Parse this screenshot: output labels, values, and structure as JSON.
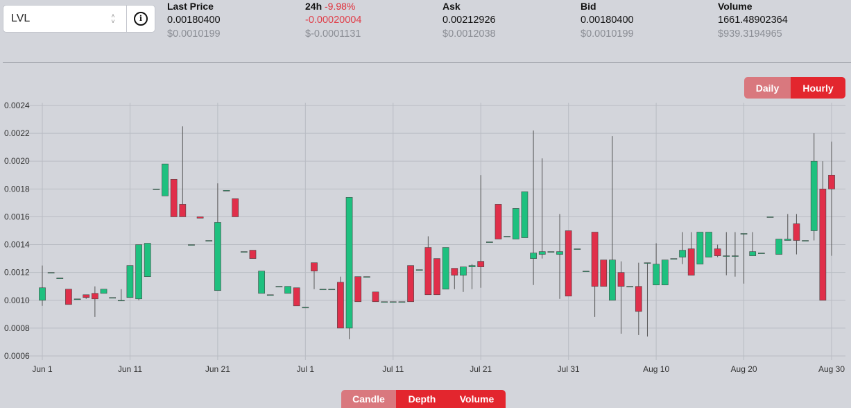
{
  "pair": {
    "symbol": "LVL"
  },
  "stats": [
    {
      "label": "Last Price",
      "pct": "",
      "value": "0.00180400",
      "usd": "$0.0010199"
    },
    {
      "label": "24h",
      "pct": "-9.98%",
      "value": "-0.00020004",
      "usd": "$-0.0001131"
    },
    {
      "label": "Ask",
      "pct": "",
      "value": "0.00212926",
      "usd": "$0.0012038"
    },
    {
      "label": "Bid",
      "pct": "",
      "value": "0.00180400",
      "usd": "$0.0010199"
    },
    {
      "label": "Volume",
      "pct": "",
      "value": "1661.48902364",
      "usd": "$939.3194965"
    }
  ],
  "interval_toggle": {
    "daily": "Daily",
    "hourly": "Hourly",
    "active": "Hourly"
  },
  "view_toggle": {
    "candle": "Candle",
    "depth": "Depth",
    "volume": "Volume"
  },
  "colors": {
    "up": "#1ec07f",
    "down": "#e02f4a",
    "wick": "#555555",
    "grid": "#b9bcc3"
  },
  "chart_data": {
    "type": "candlestick",
    "title": "",
    "xlabel": "",
    "ylabel": "",
    "ylim": [
      0.0006,
      0.0024
    ],
    "xlim": [
      "2021-06-01",
      "2021-08-30"
    ],
    "grid": true,
    "y_ticks": [
      "0.0006",
      "0.0008",
      "0.0010",
      "0.0012",
      "0.0014",
      "0.0016",
      "0.0018",
      "0.0020",
      "0.0022",
      "0.0024"
    ],
    "x_ticks": [
      {
        "date": "2021-06-01",
        "label": "Jun 1"
      },
      {
        "date": "2021-06-11",
        "label": "Jun 11"
      },
      {
        "date": "2021-06-21",
        "label": "Jun 21"
      },
      {
        "date": "2021-07-01",
        "label": "Jul 1"
      },
      {
        "date": "2021-07-11",
        "label": "Jul 11"
      },
      {
        "date": "2021-07-21",
        "label": "Jul 21"
      },
      {
        "date": "2021-07-31",
        "label": "Jul 31"
      },
      {
        "date": "2021-08-10",
        "label": "Aug 10"
      },
      {
        "date": "2021-08-20",
        "label": "Aug 20"
      },
      {
        "date": "2021-08-30",
        "label": "Aug 30"
      }
    ],
    "candles": [
      {
        "date": "2021-06-01",
        "open": 0.001,
        "high": 0.00125,
        "low": 0.00096,
        "close": 0.00109
      },
      {
        "date": "2021-06-02",
        "open": 0.0012,
        "high": 0.0012,
        "low": 0.0012,
        "close": 0.0012
      },
      {
        "date": "2021-06-03",
        "open": 0.00116,
        "high": 0.00116,
        "low": 0.00116,
        "close": 0.00116
      },
      {
        "date": "2021-06-04",
        "open": 0.00108,
        "high": 0.00108,
        "low": 0.00097,
        "close": 0.00097
      },
      {
        "date": "2021-06-05",
        "open": 0.00101,
        "high": 0.00101,
        "low": 0.00101,
        "close": 0.00101
      },
      {
        "date": "2021-06-06",
        "open": 0.00104,
        "high": 0.00104,
        "low": 0.00101,
        "close": 0.00102
      },
      {
        "date": "2021-06-07",
        "open": 0.00105,
        "high": 0.0011,
        "low": 0.00088,
        "close": 0.00101
      },
      {
        "date": "2021-06-08",
        "open": 0.00105,
        "high": 0.00108,
        "low": 0.00105,
        "close": 0.00108
      },
      {
        "date": "2021-06-09",
        "open": 0.00102,
        "high": 0.00102,
        "low": 0.00102,
        "close": 0.00102
      },
      {
        "date": "2021-06-10",
        "open": 0.001,
        "high": 0.00108,
        "low": 0.001,
        "close": 0.001
      },
      {
        "date": "2021-06-11",
        "open": 0.00102,
        "high": 0.00102,
        "low": 0.00102,
        "close": 0.00125
      },
      {
        "date": "2021-06-12",
        "open": 0.00101,
        "high": 0.0014,
        "low": 0.001,
        "close": 0.0014
      },
      {
        "date": "2021-06-13",
        "open": 0.00117,
        "high": 0.00141,
        "low": 0.00117,
        "close": 0.00141
      },
      {
        "date": "2021-06-14",
        "open": 0.0018,
        "high": 0.0018,
        "low": 0.0018,
        "close": 0.0018
      },
      {
        "date": "2021-06-15",
        "open": 0.00175,
        "high": 0.00198,
        "low": 0.00175,
        "close": 0.00198
      },
      {
        "date": "2021-06-16",
        "open": 0.00187,
        "high": 0.00187,
        "low": 0.0016,
        "close": 0.0016
      },
      {
        "date": "2021-06-17",
        "open": 0.00169,
        "high": 0.00225,
        "low": 0.0016,
        "close": 0.0016
      },
      {
        "date": "2021-06-18",
        "open": 0.0014,
        "high": 0.0014,
        "low": 0.0014,
        "close": 0.0014
      },
      {
        "date": "2021-06-19",
        "open": 0.0016,
        "high": 0.0016,
        "low": 0.00159,
        "close": 0.00159
      },
      {
        "date": "2021-06-20",
        "open": 0.00143,
        "high": 0.00143,
        "low": 0.00143,
        "close": 0.00143
      },
      {
        "date": "2021-06-21",
        "open": 0.00107,
        "high": 0.00184,
        "low": 0.00107,
        "close": 0.00156
      },
      {
        "date": "2021-06-22",
        "open": 0.00179,
        "high": 0.00179,
        "low": 0.00179,
        "close": 0.00179
      },
      {
        "date": "2021-06-23",
        "open": 0.00173,
        "high": 0.00173,
        "low": 0.0016,
        "close": 0.0016
      },
      {
        "date": "2021-06-24",
        "open": 0.00135,
        "high": 0.00135,
        "low": 0.00135,
        "close": 0.00135
      },
      {
        "date": "2021-06-25",
        "open": 0.00136,
        "high": 0.00136,
        "low": 0.0013,
        "close": 0.0013
      },
      {
        "date": "2021-06-26",
        "open": 0.00105,
        "high": 0.00121,
        "low": 0.00105,
        "close": 0.00121
      },
      {
        "date": "2021-06-27",
        "open": 0.00104,
        "high": 0.00104,
        "low": 0.00104,
        "close": 0.00104
      },
      {
        "date": "2021-06-28",
        "open": 0.0011,
        "high": 0.0011,
        "low": 0.0011,
        "close": 0.0011
      },
      {
        "date": "2021-06-29",
        "open": 0.00105,
        "high": 0.0011,
        "low": 0.00105,
        "close": 0.0011
      },
      {
        "date": "2021-06-30",
        "open": 0.00109,
        "high": 0.00109,
        "low": 0.00096,
        "close": 0.00096
      },
      {
        "date": "2021-07-01",
        "open": 0.00095,
        "high": 0.00095,
        "low": 0.00095,
        "close": 0.00095
      },
      {
        "date": "2021-07-02",
        "open": 0.00127,
        "high": 0.00127,
        "low": 0.00108,
        "close": 0.00121
      },
      {
        "date": "2021-07-03",
        "open": 0.00108,
        "high": 0.00108,
        "low": 0.00108,
        "close": 0.00108
      },
      {
        "date": "2021-07-04",
        "open": 0.00108,
        "high": 0.00108,
        "low": 0.00108,
        "close": 0.00108
      },
      {
        "date": "2021-07-05",
        "open": 0.00113,
        "high": 0.00117,
        "low": 0.0008,
        "close": 0.0008
      },
      {
        "date": "2021-07-06",
        "open": 0.0008,
        "high": 0.00174,
        "low": 0.00072,
        "close": 0.00174
      },
      {
        "date": "2021-07-07",
        "open": 0.00117,
        "high": 0.00117,
        "low": 0.00099,
        "close": 0.00099
      },
      {
        "date": "2021-07-08",
        "open": 0.00117,
        "high": 0.00117,
        "low": 0.00117,
        "close": 0.00117
      },
      {
        "date": "2021-07-09",
        "open": 0.00106,
        "high": 0.00106,
        "low": 0.00099,
        "close": 0.00099
      },
      {
        "date": "2021-07-10",
        "open": 0.00099,
        "high": 0.00099,
        "low": 0.00099,
        "close": 0.00099
      },
      {
        "date": "2021-07-11",
        "open": 0.00099,
        "high": 0.00099,
        "low": 0.00099,
        "close": 0.00099
      },
      {
        "date": "2021-07-12",
        "open": 0.00099,
        "high": 0.00099,
        "low": 0.00099,
        "close": 0.00099
      },
      {
        "date": "2021-07-13",
        "open": 0.00125,
        "high": 0.00125,
        "low": 0.00099,
        "close": 0.00099
      },
      {
        "date": "2021-07-14",
        "open": 0.00122,
        "high": 0.00122,
        "low": 0.00122,
        "close": 0.00122
      },
      {
        "date": "2021-07-15",
        "open": 0.00138,
        "high": 0.00146,
        "low": 0.00104,
        "close": 0.00104
      },
      {
        "date": "2021-07-16",
        "open": 0.0013,
        "high": 0.0013,
        "low": 0.00104,
        "close": 0.00104
      },
      {
        "date": "2021-07-17",
        "open": 0.00108,
        "high": 0.00138,
        "low": 0.00108,
        "close": 0.00138
      },
      {
        "date": "2021-07-18",
        "open": 0.00123,
        "high": 0.00123,
        "low": 0.00108,
        "close": 0.00118
      },
      {
        "date": "2021-07-19",
        "open": 0.00118,
        "high": 0.00124,
        "low": 0.00106,
        "close": 0.00124
      },
      {
        "date": "2021-07-20",
        "open": 0.00124,
        "high": 0.00126,
        "low": 0.00108,
        "close": 0.00125
      },
      {
        "date": "2021-07-21",
        "open": 0.00128,
        "high": 0.0019,
        "low": 0.00109,
        "close": 0.00124
      },
      {
        "date": "2021-07-22",
        "open": 0.00142,
        "high": 0.00142,
        "low": 0.00142,
        "close": 0.00142
      },
      {
        "date": "2021-07-23",
        "open": 0.00169,
        "high": 0.00169,
        "low": 0.00144,
        "close": 0.00144
      },
      {
        "date": "2021-07-24",
        "open": 0.00146,
        "high": 0.00146,
        "low": 0.00146,
        "close": 0.00146
      },
      {
        "date": "2021-07-25",
        "open": 0.00144,
        "high": 0.00166,
        "low": 0.00144,
        "close": 0.00166
      },
      {
        "date": "2021-07-26",
        "open": 0.00145,
        "high": 0.00178,
        "low": 0.00145,
        "close": 0.00178
      },
      {
        "date": "2021-07-27",
        "open": 0.0013,
        "high": 0.00222,
        "low": 0.00111,
        "close": 0.00134
      },
      {
        "date": "2021-07-28",
        "open": 0.00133,
        "high": 0.00202,
        "low": 0.0013,
        "close": 0.00135
      },
      {
        "date": "2021-07-29",
        "open": 0.00135,
        "high": 0.00135,
        "low": 0.00135,
        "close": 0.00135
      },
      {
        "date": "2021-07-30",
        "open": 0.00133,
        "high": 0.00162,
        "low": 0.00101,
        "close": 0.00135
      },
      {
        "date": "2021-07-31",
        "open": 0.0015,
        "high": 0.0015,
        "low": 0.00103,
        "close": 0.00103
      },
      {
        "date": "2021-08-01",
        "open": 0.00137,
        "high": 0.00137,
        "low": 0.00137,
        "close": 0.00137
      },
      {
        "date": "2021-08-02",
        "open": 0.00121,
        "high": 0.00121,
        "low": 0.00121,
        "close": 0.00121
      },
      {
        "date": "2021-08-03",
        "open": 0.00149,
        "high": 0.00149,
        "low": 0.00088,
        "close": 0.0011
      },
      {
        "date": "2021-08-04",
        "open": 0.00129,
        "high": 0.00129,
        "low": 0.0011,
        "close": 0.0011
      },
      {
        "date": "2021-08-05",
        "open": 0.001,
        "high": 0.00218,
        "low": 0.001,
        "close": 0.00129
      },
      {
        "date": "2021-08-06",
        "open": 0.0012,
        "high": 0.00128,
        "low": 0.00076,
        "close": 0.0011
      },
      {
        "date": "2021-08-07",
        "open": 0.0011,
        "high": 0.0011,
        "low": 0.0011,
        "close": 0.0011
      },
      {
        "date": "2021-08-08",
        "open": 0.0011,
        "high": 0.00127,
        "low": 0.00075,
        "close": 0.00092
      },
      {
        "date": "2021-08-09",
        "open": 0.00127,
        "high": 0.00127,
        "low": 0.00074,
        "close": 0.00127
      },
      {
        "date": "2021-08-10",
        "open": 0.00111,
        "high": 0.00141,
        "low": 0.00111,
        "close": 0.00126
      },
      {
        "date": "2021-08-11",
        "open": 0.00111,
        "high": 0.00129,
        "low": 0.00111,
        "close": 0.00129
      },
      {
        "date": "2021-08-12",
        "open": 0.0013,
        "high": 0.0013,
        "low": 0.0013,
        "close": 0.0013
      },
      {
        "date": "2021-08-13",
        "open": 0.00131,
        "high": 0.00149,
        "low": 0.00126,
        "close": 0.00136
      },
      {
        "date": "2021-08-14",
        "open": 0.00137,
        "high": 0.00149,
        "low": 0.00118,
        "close": 0.00118
      },
      {
        "date": "2021-08-15",
        "open": 0.00126,
        "high": 0.00149,
        "low": 0.00126,
        "close": 0.00149
      },
      {
        "date": "2021-08-16",
        "open": 0.00131,
        "high": 0.00149,
        "low": 0.00131,
        "close": 0.00149
      },
      {
        "date": "2021-08-17",
        "open": 0.00137,
        "high": 0.0014,
        "low": 0.00131,
        "close": 0.00132
      },
      {
        "date": "2021-08-18",
        "open": 0.00132,
        "high": 0.00149,
        "low": 0.00118,
        "close": 0.00132
      },
      {
        "date": "2021-08-19",
        "open": 0.00132,
        "high": 0.00149,
        "low": 0.00117,
        "close": 0.00132
      },
      {
        "date": "2021-08-20",
        "open": 0.00148,
        "high": 0.00148,
        "low": 0.00112,
        "close": 0.00148
      },
      {
        "date": "2021-08-21",
        "open": 0.00132,
        "high": 0.00149,
        "low": 0.00132,
        "close": 0.00135
      },
      {
        "date": "2021-08-22",
        "open": 0.00134,
        "high": 0.00134,
        "low": 0.00134,
        "close": 0.00134
      },
      {
        "date": "2021-08-23",
        "open": 0.0016,
        "high": 0.0016,
        "low": 0.0016,
        "close": 0.0016
      },
      {
        "date": "2021-08-24",
        "open": 0.00133,
        "high": 0.00144,
        "low": 0.00133,
        "close": 0.00144
      },
      {
        "date": "2021-08-25",
        "open": 0.00143,
        "high": 0.00162,
        "low": 0.00143,
        "close": 0.00144
      },
      {
        "date": "2021-08-26",
        "open": 0.00155,
        "high": 0.00162,
        "low": 0.00133,
        "close": 0.00143
      },
      {
        "date": "2021-08-27",
        "open": 0.00143,
        "high": 0.00143,
        "low": 0.00143,
        "close": 0.00143
      },
      {
        "date": "2021-08-28",
        "open": 0.0015,
        "high": 0.0022,
        "low": 0.00143,
        "close": 0.002
      },
      {
        "date": "2021-08-29",
        "open": 0.0018,
        "high": 0.002,
        "low": 0.001,
        "close": 0.001
      },
      {
        "date": "2021-08-30",
        "open": 0.0019,
        "high": 0.00214,
        "low": 0.00132,
        "close": 0.0018
      }
    ]
  }
}
